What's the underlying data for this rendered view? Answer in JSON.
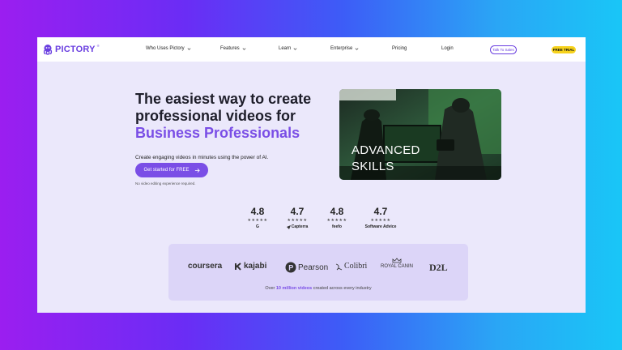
{
  "brand": {
    "name": "PICTORY",
    "reg": "®",
    "accent": "#7a4ee6",
    "cta_yellow": "#f6d21c"
  },
  "nav": {
    "items": [
      {
        "label": "Who Uses Pictory",
        "dropdown": true
      },
      {
        "label": "Features",
        "dropdown": true
      },
      {
        "label": "Learn",
        "dropdown": true
      },
      {
        "label": "Enterprise",
        "dropdown": true
      },
      {
        "label": "Pricing",
        "dropdown": false
      },
      {
        "label": "Login",
        "dropdown": false
      }
    ],
    "talk_to_sales": "Talk To Sales",
    "free_trial": "FREE TRIAL"
  },
  "hero": {
    "line1": "The easiest way to create",
    "line2": "professional videos for",
    "accent_line": "Business Professionals",
    "subtitle": "Create engaging videos in minutes using the power of AI.",
    "cta_label": "Get started for FREE",
    "note": "No video editing experience required.",
    "video_overlay": "ADVANCED\nSKILLS"
  },
  "ratings": [
    {
      "score": "4.8",
      "stars": "★★★★★",
      "source": "G",
      "icon": "g2-icon"
    },
    {
      "score": "4.7",
      "stars": "★★★★★",
      "source": "Capterra",
      "icon": "capterra-icon"
    },
    {
      "score": "4.8",
      "stars": "★★★★★",
      "source": "feefo",
      "icon": "feefo-icon"
    },
    {
      "score": "4.7",
      "stars": "★★★★★",
      "source": "Software Advice",
      "icon": "software-advice-icon"
    }
  ],
  "logos": {
    "brands": [
      "coursera",
      "kajabi",
      "Pearson",
      "Colibri",
      "ROYAL CANIN",
      "D2L"
    ],
    "caption_pre": "Over ",
    "caption_hl": "10 million videos",
    "caption_post": " created across every industry"
  }
}
